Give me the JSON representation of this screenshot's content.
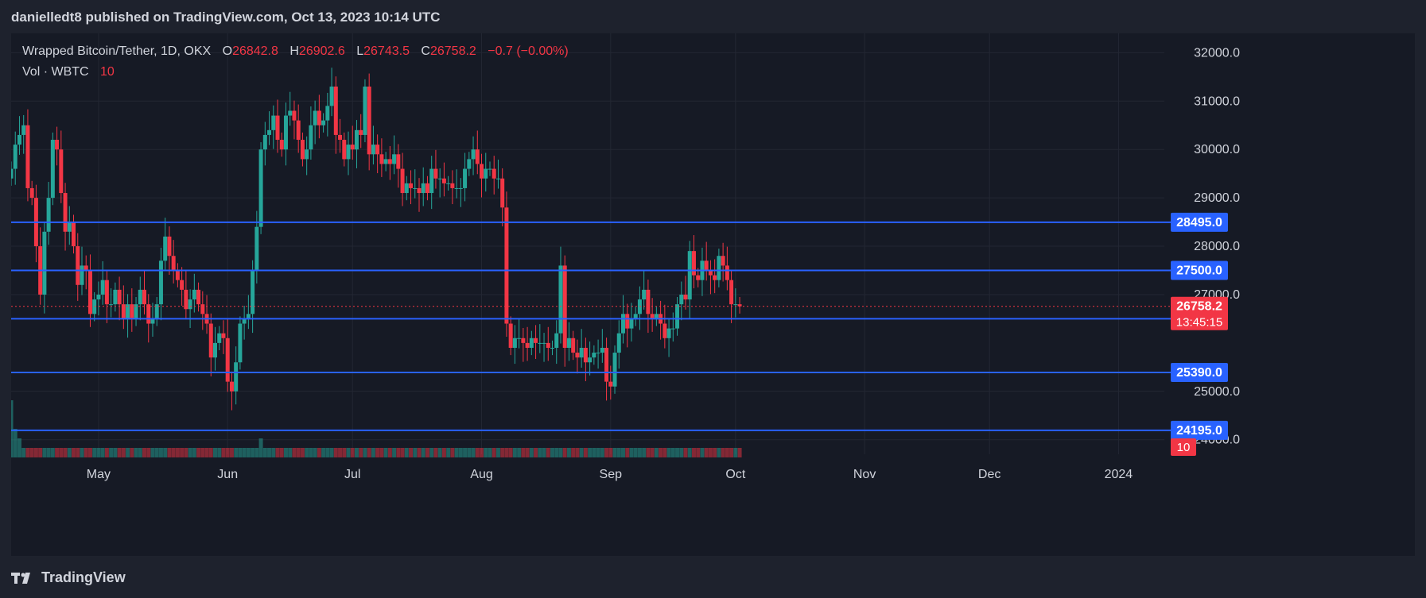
{
  "header": {
    "text": "danielledt8 published on TradingView.com, Oct 13, 2023 10:14 UTC"
  },
  "legend": {
    "symbol": "Wrapped Bitcoin/Tether, 1D, OKX",
    "o_label": "O",
    "o_value": "26842.8",
    "h_label": "H",
    "h_value": "26902.6",
    "l_label": "L",
    "l_value": "26743.5",
    "c_label": "C",
    "c_value": "26758.2",
    "change": "−0.7 (−0.00%)",
    "vol_label": "Vol · WBTC",
    "vol_value": "10"
  },
  "footer": {
    "brand": "TradingView"
  },
  "colors": {
    "up": "#26a69a",
    "down": "#f23645",
    "level_line": "#2962ff",
    "background": "#161a25",
    "grid": "#232733"
  },
  "icons": {
    "brand_logo": "tradingview-logo-icon"
  },
  "chart_data": {
    "type": "candlestick",
    "title": "Wrapped Bitcoin/Tether, 1D, OKX",
    "ylim": [
      23700,
      32400
    ],
    "y_ticks": [
      "32000.0",
      "31000.0",
      "30000.0",
      "29000.0",
      "28000.0",
      "27000.0",
      "25000.0",
      "24000.0"
    ],
    "x_ticks": [
      "May",
      "Jun",
      "Jul",
      "Aug",
      "Sep",
      "Oct",
      "Nov",
      "Dec",
      "2024"
    ],
    "x_range": [
      "2023-04-10",
      "2024-01-12"
    ],
    "grid": true,
    "horizontal_levels": [
      {
        "value": 28495.0,
        "label": "28495.0"
      },
      {
        "value": 27500.0,
        "label": "27500.0"
      },
      {
        "value": 26500.0,
        "label": "26500.0"
      },
      {
        "value": 25390.0,
        "label": "25390.0"
      },
      {
        "value": 24195.0,
        "label": "24195.0"
      }
    ],
    "current_price": {
      "value": 26758.2,
      "label": "26758.2",
      "countdown": "13:45:15"
    },
    "volume_badge": "10",
    "closes": [
      29600,
      30100,
      30300,
      30500,
      29200,
      29000,
      28000,
      27000,
      28300,
      29000,
      30200,
      30000,
      29100,
      28300,
      28500,
      28000,
      27200,
      27600,
      27500,
      26600,
      26900,
      27000,
      27300,
      26800,
      26800,
      27100,
      26800,
      26500,
      26800,
      26500,
      26800,
      27100,
      26800,
      26400,
      26500,
      26800,
      27700,
      28200,
      27800,
      27500,
      27300,
      27100,
      26700,
      26900,
      27100,
      26800,
      26600,
      26400,
      25700,
      26000,
      26200,
      26100,
      25200,
      25000,
      25600,
      26400,
      26500,
      26600,
      27500,
      28400,
      30000,
      30300,
      30400,
      30700,
      30200,
      30000,
      30700,
      30800,
      30600,
      30200,
      29800,
      30000,
      30500,
      30800,
      30500,
      30600,
      30900,
      31300,
      30300,
      30200,
      29800,
      30100,
      30000,
      30400,
      30300,
      31300,
      29900,
      30100,
      29900,
      29700,
      29800,
      29700,
      29900,
      29600,
      29100,
      29300,
      29200,
      29200,
      29100,
      29300,
      29100,
      29600,
      29400,
      29400,
      29300,
      29300,
      29200,
      29200,
      29200,
      29600,
      29800,
      30000,
      29700,
      29400,
      29600,
      29600,
      29400,
      29400,
      28800,
      26400,
      25900,
      26100,
      26100,
      26000,
      25900,
      26100,
      26000,
      26000,
      26000,
      25900,
      25900,
      26200,
      27600,
      25900,
      26100,
      25800,
      25700,
      25900,
      25600,
      25700,
      25800,
      25800,
      25900,
      25200,
      25100,
      25800,
      26200,
      26600,
      26300,
      26500,
      26600,
      26900,
      27100,
      26600,
      26500,
      26600,
      26400,
      26100,
      26300,
      26300,
      26800,
      27000,
      26900,
      27900,
      27400,
      27300,
      27700,
      27500,
      27400,
      27300,
      27800,
      27600,
      27300,
      26800,
      26800,
      26758
    ],
    "volumes": [
      6,
      3,
      2,
      1,
      1,
      1,
      1,
      1,
      1,
      1,
      1,
      1,
      1,
      1,
      1,
      1,
      1,
      1,
      1,
      1,
      1,
      1,
      1,
      1,
      1,
      1,
      1,
      1,
      1,
      1,
      1,
      1,
      1,
      1,
      1,
      1,
      1,
      1,
      1,
      1,
      1,
      1,
      1,
      1,
      1,
      1,
      1,
      1,
      1,
      1,
      1,
      1,
      1,
      1,
      1,
      1,
      1,
      1,
      1,
      1,
      2,
      1,
      1,
      1,
      1,
      1,
      1,
      1,
      1,
      1,
      1,
      1,
      1,
      1,
      1,
      1,
      1,
      1,
      1,
      1,
      1,
      1,
      1,
      1,
      1,
      1,
      1,
      1,
      1,
      1,
      1,
      1,
      1,
      1,
      1,
      1,
      1,
      1,
      1,
      1,
      1,
      1,
      1,
      1,
      1,
      1,
      1,
      1,
      1,
      1,
      1,
      1,
      1,
      1,
      1,
      1,
      1,
      1,
      1,
      1,
      1,
      1,
      1,
      1,
      1,
      1,
      1,
      1,
      1,
      1,
      1,
      1,
      1,
      1,
      1,
      1,
      1,
      1,
      1,
      1,
      1,
      1,
      1,
      1,
      1,
      1,
      1,
      1,
      1,
      1,
      1,
      1,
      1,
      1,
      1,
      1,
      1,
      1,
      1,
      1,
      1,
      1,
      1,
      1,
      1,
      1,
      1,
      1,
      1,
      1,
      1,
      1,
      1,
      1,
      1
    ]
  }
}
